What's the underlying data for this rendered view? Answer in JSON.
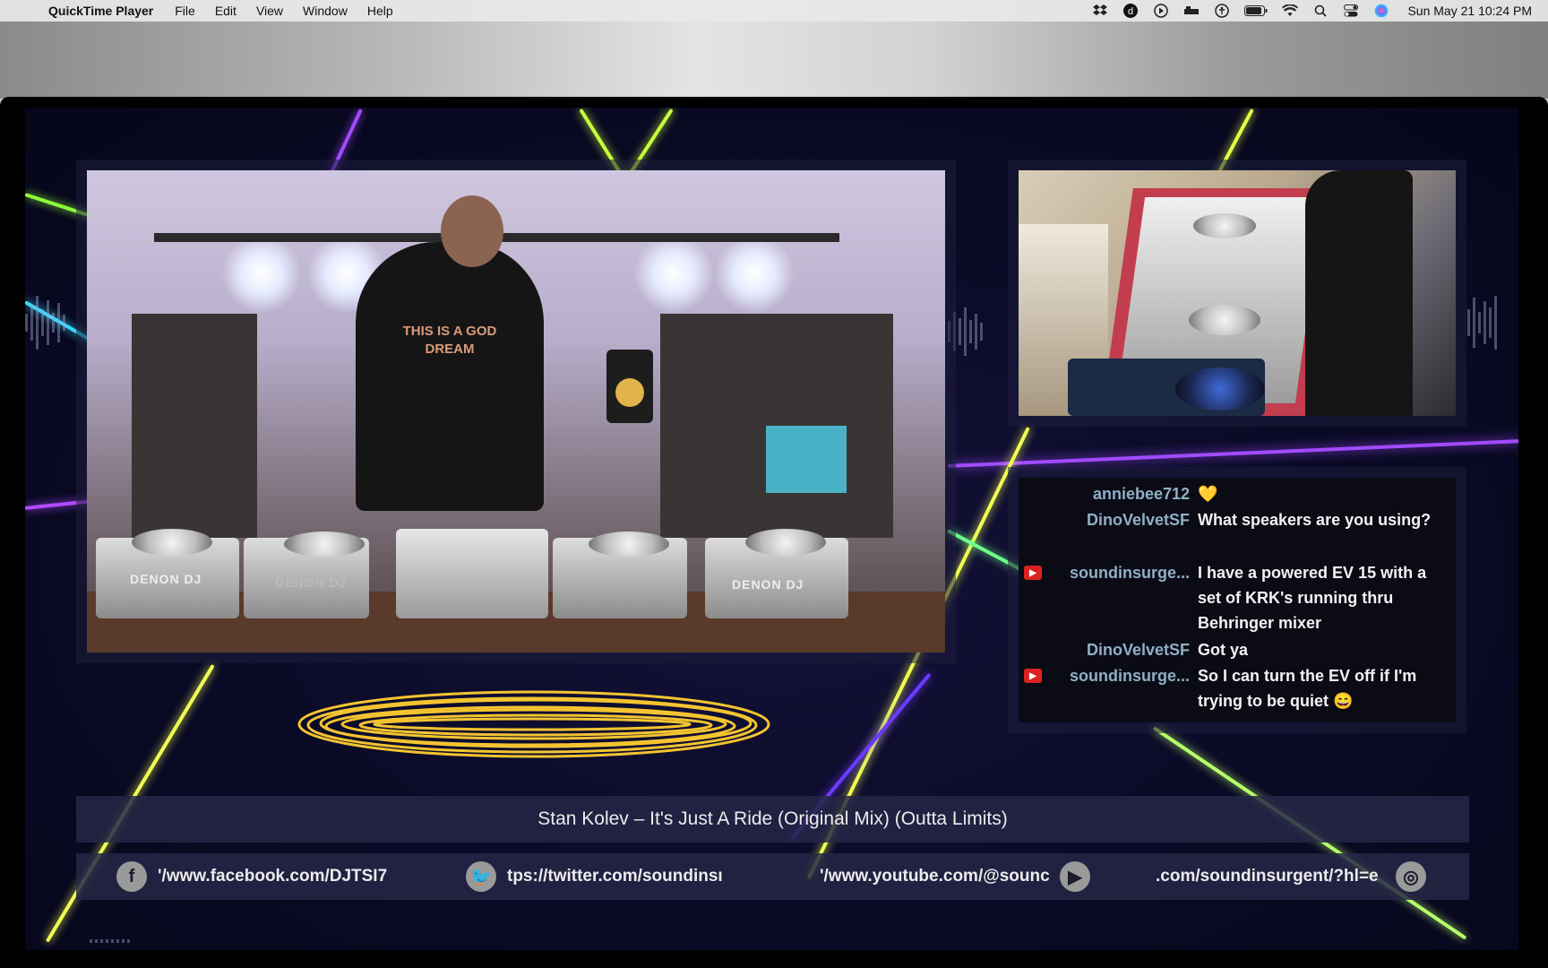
{
  "menubar": {
    "app_name": "QuickTime Player",
    "items": [
      "File",
      "Edit",
      "View",
      "Window",
      "Help"
    ],
    "status_icons": [
      "dropbox-icon",
      "d-app-icon",
      "play-circle-icon",
      "bed-icon",
      "accessibility-icon",
      "battery-icon",
      "wifi-icon",
      "search-icon",
      "control-center-icon",
      "siri-icon"
    ],
    "clock": "Sun May 21  10:24 PM"
  },
  "video": {
    "deck_labels": [
      "DENON DJ",
      "DENON DJ",
      "DENON DJ"
    ],
    "shirt_text": "THIS IS A GOD DREAM"
  },
  "chat": {
    "messages": [
      {
        "user": "anniebee712",
        "text": "💛",
        "mod": false
      },
      {
        "user": "DinoVelvetSF",
        "text": "What speakers are you using?",
        "mod": false
      },
      {
        "user": "soundinsurge...",
        "text": "I have a powered EV 15 with a set of KRK's running thru Behringer mixer",
        "mod": true
      },
      {
        "user": "DinoVelvetSF",
        "text": "Got ya",
        "mod": false
      },
      {
        "user": "soundinsurge...",
        "text": "So I can turn the EV off if I'm trying to be quiet 😄",
        "mod": true
      }
    ]
  },
  "now_playing": "Stan Kolev – It's Just A Ride (Original Mix) (Outta Limits)",
  "social": {
    "facebook": {
      "icon": "f",
      "text": "'/www.facebook.com/DJTSI7"
    },
    "twitter": {
      "icon": "🐦",
      "text": "tps://twitter.com/soundinsı"
    },
    "youtube": {
      "icon": "▶",
      "text": "'/www.youtube.com/@sounc"
    },
    "instagram": {
      "icon": "◎",
      "text": ".com/soundinsurgent/?hl=e"
    }
  },
  "colors": {
    "beam_green": "#b7ff3a",
    "beam_purple": "#a14bff",
    "beam_yellow": "#f0ff52",
    "chat_user": "#8fb0c4",
    "scribble": "#f4c430",
    "mod_badge": "#dd2222"
  }
}
